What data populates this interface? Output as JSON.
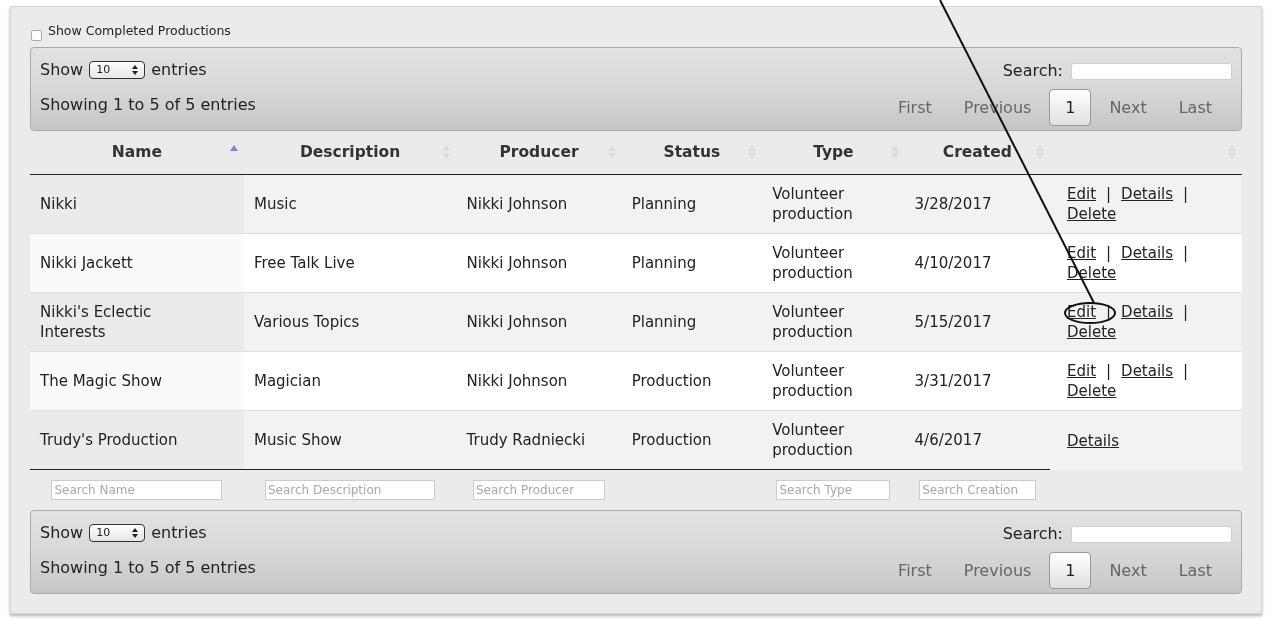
{
  "show_completed": {
    "label": "Show Completed Productions",
    "checked": false
  },
  "top_toolbar": {
    "show_label": "Show",
    "page_size": "10",
    "entries_label": "entries",
    "search_label": "Search:",
    "info": "Showing 1 to 5 of 5 entries",
    "pager": [
      {
        "label": "First",
        "selected": false
      },
      {
        "label": "Previous",
        "selected": false
      },
      {
        "label": "1",
        "selected": true
      },
      {
        "label": "Next",
        "selected": false
      },
      {
        "label": "Last",
        "selected": false
      }
    ]
  },
  "table": {
    "columns": [
      {
        "label": "Name",
        "sorted": true
      },
      {
        "label": "Description",
        "sorted": false
      },
      {
        "label": "Producer",
        "sorted": false
      },
      {
        "label": "Status",
        "sorted": false
      },
      {
        "label": "Type",
        "sorted": false
      },
      {
        "label": "Created",
        "sorted": false
      },
      {
        "sorted": false
      }
    ],
    "rows": [
      {
        "cells": [
          "Nikki",
          "Music",
          "Nikki Johnson",
          "Planning",
          "Volunteer production",
          "3/28/2017"
        ],
        "actions": [
          "Edit",
          "|",
          "Details",
          "|",
          "Delete"
        ]
      },
      {
        "cells": [
          "Nikki Jackett",
          "Free Talk Live",
          "Nikki Johnson",
          "Planning",
          "Volunteer production",
          "4/10/2017"
        ],
        "actions": [
          "Edit",
          "|",
          "Details",
          "|",
          "Delete"
        ]
      },
      {
        "cells": [
          "Nikki's Eclectic Interests",
          "Various Topics",
          "Nikki Johnson",
          "Planning",
          "Volunteer production",
          "5/15/2017"
        ],
        "actions": [
          "Edit",
          "|",
          "Details",
          "|",
          "Delete"
        ]
      },
      {
        "cells": [
          "The Magic Show",
          "Magician",
          "Nikki Johnson",
          "Production",
          "Volunteer production",
          "3/31/2017"
        ],
        "actions": [
          "Edit",
          "|",
          "Details",
          "|",
          "Delete"
        ]
      },
      {
        "cells": [
          "Trudy's Production",
          "Music Show",
          "Trudy Radniecki",
          "Production",
          "Volunteer production",
          "4/6/2017"
        ],
        "actions": [
          "Details"
        ]
      }
    ]
  },
  "column_filters": [
    {
      "kind": "field",
      "placeholder": "Search Name"
    },
    {
      "kind": "field",
      "placeholder": "Search Description"
    },
    {
      "kind": "field",
      "placeholder": "Search Producer"
    },
    {
      "kind": "blank"
    },
    {
      "kind": "field",
      "placeholder": "Search Type"
    },
    {
      "kind": "field",
      "placeholder": "Search Creation"
    },
    {
      "kind": "blank"
    }
  ],
  "bottom_toolbar": {
    "show_label": "Show",
    "page_size": "10",
    "entries_label": "entries",
    "search_label": "Search:",
    "info": "Showing 1 to 5 of 5 entries",
    "pager": [
      {
        "label": "First",
        "selected": false
      },
      {
        "label": "Previous",
        "selected": false
      },
      {
        "label": "1",
        "selected": true
      },
      {
        "label": "Next",
        "selected": false
      },
      {
        "label": "Last",
        "selected": false
      }
    ]
  }
}
